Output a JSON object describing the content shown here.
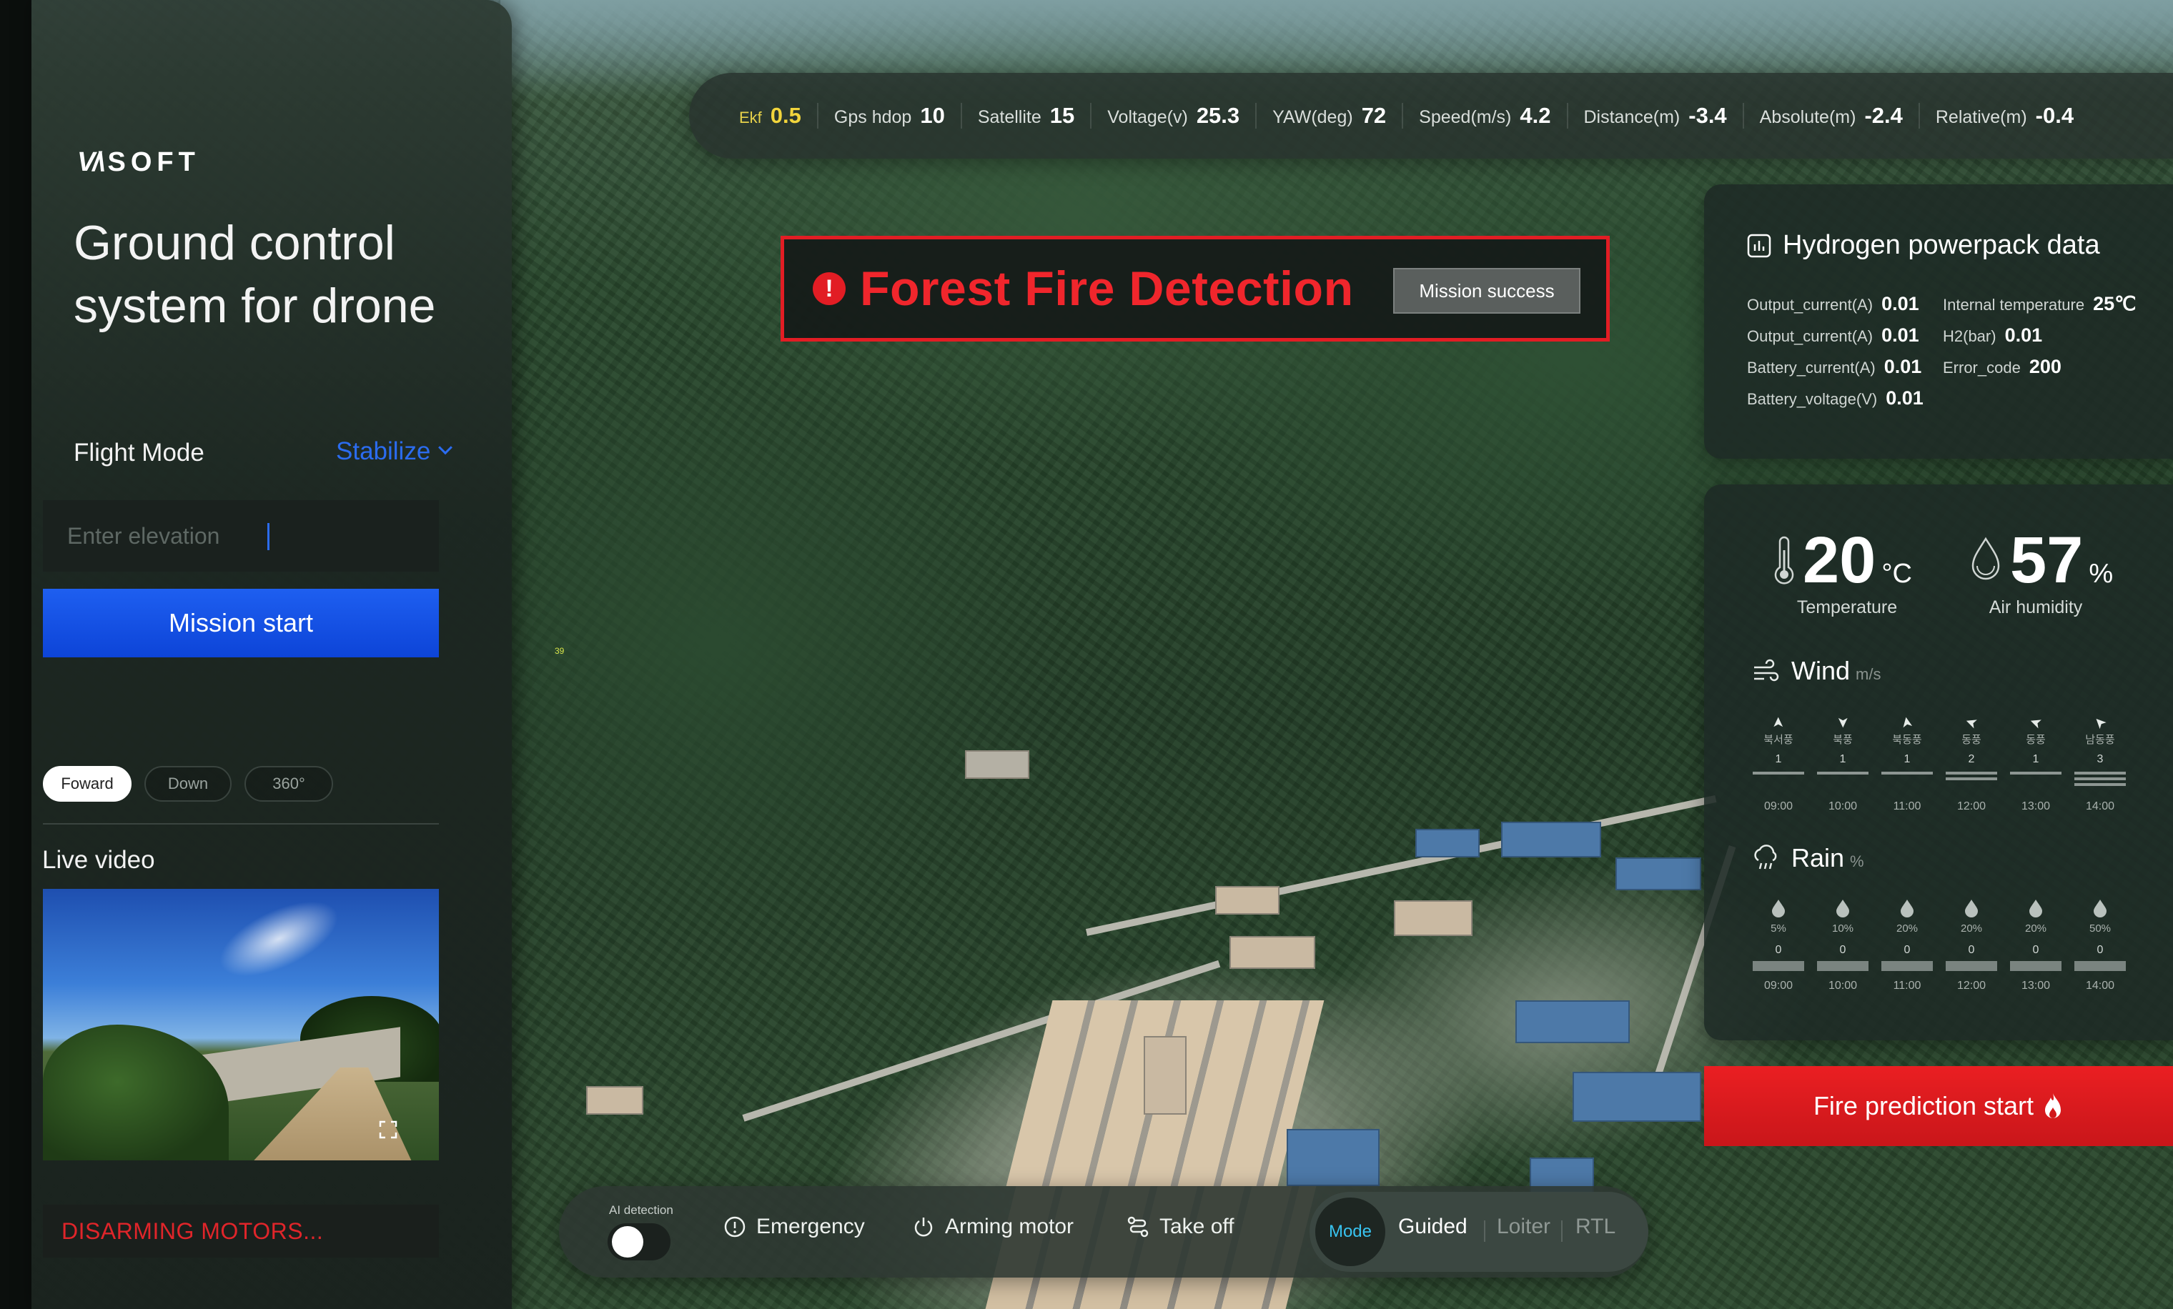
{
  "brand": {
    "logo_mark": "V/\\",
    "logo_text": "SOFT"
  },
  "app": {
    "title": "Ground control system for drone"
  },
  "flight_mode": {
    "label": "Flight Mode",
    "selected": "Stabilize"
  },
  "elevation": {
    "placeholder": "Enter elevation"
  },
  "mission": {
    "start_label": "Mission start"
  },
  "camera": {
    "tabs": [
      "Foward",
      "Down",
      "360°"
    ],
    "active": "Foward"
  },
  "live_video": {
    "label": "Live video"
  },
  "status": {
    "text": "DISARMING MOTORS..."
  },
  "telemetry": [
    {
      "label": "Ekf",
      "value": "0.5",
      "warn": true
    },
    {
      "label": "Gps hdop",
      "value": "10"
    },
    {
      "label": "Satellite",
      "value": "15"
    },
    {
      "label": "Voltage(v)",
      "value": "25.3"
    },
    {
      "label": "YAW(deg)",
      "value": "72"
    },
    {
      "label": "Speed(m/s)",
      "value": "4.2"
    },
    {
      "label": "Distance(m)",
      "value": "-3.4"
    },
    {
      "label": "Absolute(m)",
      "value": "-2.4"
    },
    {
      "label": "Relative(m)",
      "value": "-0.4"
    }
  ],
  "alert": {
    "icon": "!",
    "title": "Forest Fire Detection",
    "button": "Mission success"
  },
  "hydrogen": {
    "title": "Hydrogen powerpack data",
    "left": [
      {
        "label": "Output_current(A)",
        "value": "0.01"
      },
      {
        "label": "Output_current(A)",
        "value": "0.01"
      },
      {
        "label": "Battery_current(A)",
        "value": "0.01"
      },
      {
        "label": "Battery_voltage(V)",
        "value": "0.01"
      }
    ],
    "right": [
      {
        "label": "Internal temperature",
        "value": "25℃"
      },
      {
        "label": "H2(bar)",
        "value": "0.01"
      },
      {
        "label": "Error_code",
        "value": "200"
      }
    ]
  },
  "weather": {
    "temperature": {
      "value": "20",
      "unit": "°C",
      "label": "Temperature"
    },
    "humidity": {
      "value": "57",
      "unit": "%",
      "label": "Air humidity"
    },
    "wind": {
      "title": "Wind",
      "unit": "m/s",
      "items": [
        {
          "dir": "북서풍",
          "speed": "1",
          "time": "09:00",
          "arrow": "➤",
          "rot": -90
        },
        {
          "dir": "북풍",
          "speed": "1",
          "time": "10:00",
          "arrow": "➤",
          "rot": 90
        },
        {
          "dir": "북동풍",
          "speed": "1",
          "time": "11:00",
          "arrow": "➤",
          "rot": -100
        },
        {
          "dir": "동풍",
          "speed": "2",
          "time": "12:00",
          "arrow": "➤",
          "rot": 200
        },
        {
          "dir": "동풍",
          "speed": "1",
          "time": "13:00",
          "arrow": "➤",
          "rot": 200
        },
        {
          "dir": "남동풍",
          "speed": "3",
          "time": "14:00",
          "arrow": "➤",
          "rot": -135
        }
      ]
    },
    "rain": {
      "title": "Rain",
      "unit": "%",
      "items": [
        {
          "pct": "5%",
          "amount": "0",
          "time": "09:00"
        },
        {
          "pct": "10%",
          "amount": "0",
          "time": "10:00"
        },
        {
          "pct": "20%",
          "amount": "0",
          "time": "11:00"
        },
        {
          "pct": "20%",
          "amount": "0",
          "time": "12:00"
        },
        {
          "pct": "20%",
          "amount": "0",
          "time": "13:00"
        },
        {
          "pct": "50%",
          "amount": "0",
          "time": "14:00"
        }
      ]
    }
  },
  "fire": {
    "button": "Fire prediction start"
  },
  "controls": {
    "ai_label": "AI detection",
    "emergency": "Emergency",
    "arming": "Arming motor",
    "takeoff": "Take off",
    "mode_badge": "Mode",
    "modes": [
      "Guided",
      "Loiter",
      "RTL"
    ],
    "active_mode": "Guided"
  },
  "map": {
    "marker": "39"
  },
  "colors": {
    "accent_blue": "#0d44d8",
    "alert_red": "#e21d24",
    "warn_yellow": "#f2d53c",
    "mode_cyan": "#38c3f0"
  }
}
